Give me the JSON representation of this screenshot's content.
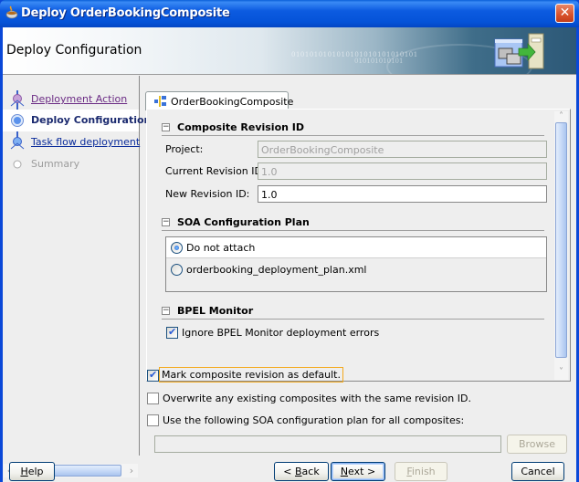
{
  "window": {
    "title": "Deploy OrderBookingComposite",
    "title_icon": "coffee-cup-icon",
    "close_icon": "close-icon"
  },
  "banner": {
    "title": "Deploy Configuration",
    "binary_text_1": "0101010101010101010101010101",
    "binary_text_2": "010101010101",
    "icon": "deploy-to-server-icon"
  },
  "steps": [
    {
      "label": "Deployment Action",
      "state": "done"
    },
    {
      "label": "Deploy Configuration",
      "state": "current"
    },
    {
      "label": "Task flow deployment",
      "state": "next"
    },
    {
      "label": "Summary",
      "state": "disabled"
    }
  ],
  "tab": {
    "label": "OrderBookingComposite",
    "icon": "composite-icon"
  },
  "composite_revision": {
    "header": "Composite Revision ID",
    "toggle": "−",
    "project_label": "Project:",
    "project_value": "OrderBookingComposite",
    "current_revision_label": "Current Revision ID:",
    "current_revision_value": "1.0",
    "new_revision_label": "New Revision ID:",
    "new_revision_value": "1.0"
  },
  "soa_plan": {
    "header": "SOA Configuration Plan",
    "toggle": "−",
    "options": [
      {
        "label": "Do not attach",
        "selected": true
      },
      {
        "label": "orderbooking_deployment_plan.xml",
        "selected": false
      }
    ]
  },
  "bpel_monitor": {
    "header": "BPEL Monitor",
    "toggle": "−",
    "ignore_errors_label": "Ignore BPEL Monitor deployment errors",
    "ignore_errors_checked": true
  },
  "options": {
    "mark_default_label": "Mark composite revision as default.",
    "mark_default_checked": true,
    "overwrite_label": "Overwrite any existing composites with the same revision ID.",
    "overwrite_checked": false,
    "use_plan_label": "Use the following SOA configuration plan for all composites:",
    "use_plan_checked": false,
    "plan_path_value": ""
  },
  "buttons": {
    "browse": "Browse",
    "help_mnemonic": "H",
    "help_rest": "elp",
    "back_prefix": "< ",
    "back_mnemonic": "B",
    "back_rest": "ack",
    "next_mnemonic": "N",
    "next_rest": "ext >",
    "finish_mnemonic": "F",
    "finish_rest": "inish",
    "cancel": "Cancel"
  },
  "scroll": {
    "left_arrow": "‹",
    "right_arrow": "›",
    "up_arrow": "˄",
    "down_arrow": "˅"
  }
}
